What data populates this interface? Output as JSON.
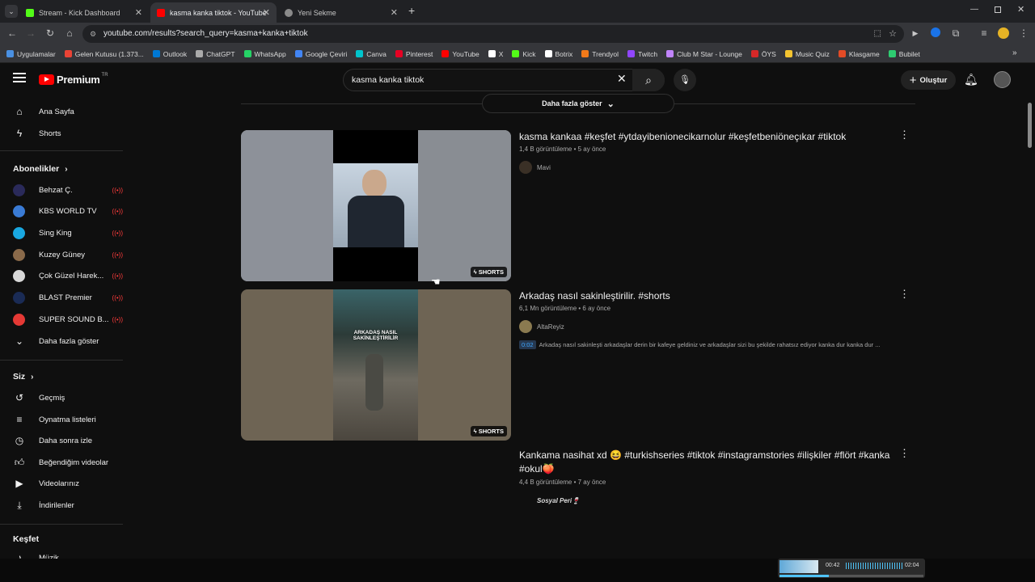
{
  "browser": {
    "tabs": [
      {
        "title": "Stream - Kick Dashboard",
        "color": "#53fc18"
      },
      {
        "title": "kasma kanka tiktok - YouTube",
        "color": "#ff0000"
      },
      {
        "title": "Yeni Sekme",
        "color": "#8a8a8a"
      }
    ],
    "url": "youtube.com/results?search_query=kasma+kanka+tiktok",
    "bookmarks": [
      {
        "label": "Uygulamalar",
        "color": "#4a90e2"
      },
      {
        "label": "Gelen Kutusu (1.373...",
        "color": "#ea4335"
      },
      {
        "label": "Outlook",
        "color": "#0078d4"
      },
      {
        "label": "ChatGPT",
        "color": "#aaaaaa"
      },
      {
        "label": "WhatsApp",
        "color": "#25d366"
      },
      {
        "label": "Google Çeviri",
        "color": "#4285f4"
      },
      {
        "label": "Canva",
        "color": "#00c4cc"
      },
      {
        "label": "Pinterest",
        "color": "#e60023"
      },
      {
        "label": "YouTube",
        "color": "#ff0000"
      },
      {
        "label": "X",
        "color": "#ffffff"
      },
      {
        "label": "Kick",
        "color": "#53fc18"
      },
      {
        "label": "Botrix",
        "color": "#ffffff"
      },
      {
        "label": "Trendyol",
        "color": "#f27a1a"
      },
      {
        "label": "Twitch",
        "color": "#9146ff"
      },
      {
        "label": "Club M Star - Lounge",
        "color": "#c084fc"
      },
      {
        "label": "ÖYS",
        "color": "#d62828"
      },
      {
        "label": "Music Quiz",
        "color": "#f4c430"
      },
      {
        "label": "Klasgame",
        "color": "#e34b26"
      },
      {
        "label": "Bubilet",
        "color": "#2ecc71"
      }
    ]
  },
  "yt": {
    "logo": "Premium",
    "logo_sup": "TR",
    "search_value": "kasma kanka tiktok",
    "create_label": "Oluştur",
    "more_label": "Daha fazla göster",
    "sidebar": {
      "home": "Ana Sayfa",
      "shorts": "Shorts",
      "subs_head": "Abonelikler",
      "subs": [
        {
          "name": "Behzat Ç.",
          "color": "#2a2a5a"
        },
        {
          "name": "KBS WORLD TV",
          "color": "#3a7bd5"
        },
        {
          "name": "Sing King",
          "color": "#19a7e0"
        },
        {
          "name": "Kuzey Güney",
          "color": "#8a6a4a"
        },
        {
          "name": "Çok Güzel Harek...",
          "color": "#d8d8d8"
        },
        {
          "name": "BLAST Premier",
          "color": "#1a2b55"
        },
        {
          "name": "SUPER SOUND B...",
          "color": "#e53935"
        }
      ],
      "show_more": "Daha fazla göster",
      "you_head": "Siz",
      "you_items": [
        "Geçmiş",
        "Oynatma listeleri",
        "Daha sonra izle",
        "Beğendiğim videolar",
        "Videolarınız",
        "İndirilenler"
      ],
      "explore_head": "Keşfet",
      "music": "Müzik"
    },
    "videos": [
      {
        "title": "kasma kankaa #keşfet #ytdayibenionecikarnolur #keşfetbeniöneçıkar #tiktok",
        "meta": "1,4 B görüntüleme • 5 ay önce",
        "channel": "Mavi",
        "badge": "SHORTS"
      },
      {
        "title": "Arkadaş nasıl sakinleştirilir. #shorts",
        "meta": "6,1 Mn görüntüleme • 6 ay önce",
        "channel": "AltaReyiz",
        "badge": "SHORTS",
        "chapter_time": "0:02",
        "snippet": "Arkadaş nasıl sakinleşti arkadaşlar derin bir kafeye geldiniz ve arkadaşlar sizi bu şekilde rahatsız ediyor kanka dur kanka dur ..."
      },
      {
        "title": "Kankama nasihat xd 😆 #turkishseries #tiktok #instagramstories #ilişkiler #flört #kanka #okul🍑",
        "meta": "4,4 B görüntüleme • 7 ay önce",
        "channel": "Sosyal Peri🍷"
      }
    ],
    "thumb_text": "ARKADAŞ NASIL SAKİNLEŞTİRİLİR",
    "mini_player": {
      "current": "00:42",
      "total": "02:04"
    }
  }
}
